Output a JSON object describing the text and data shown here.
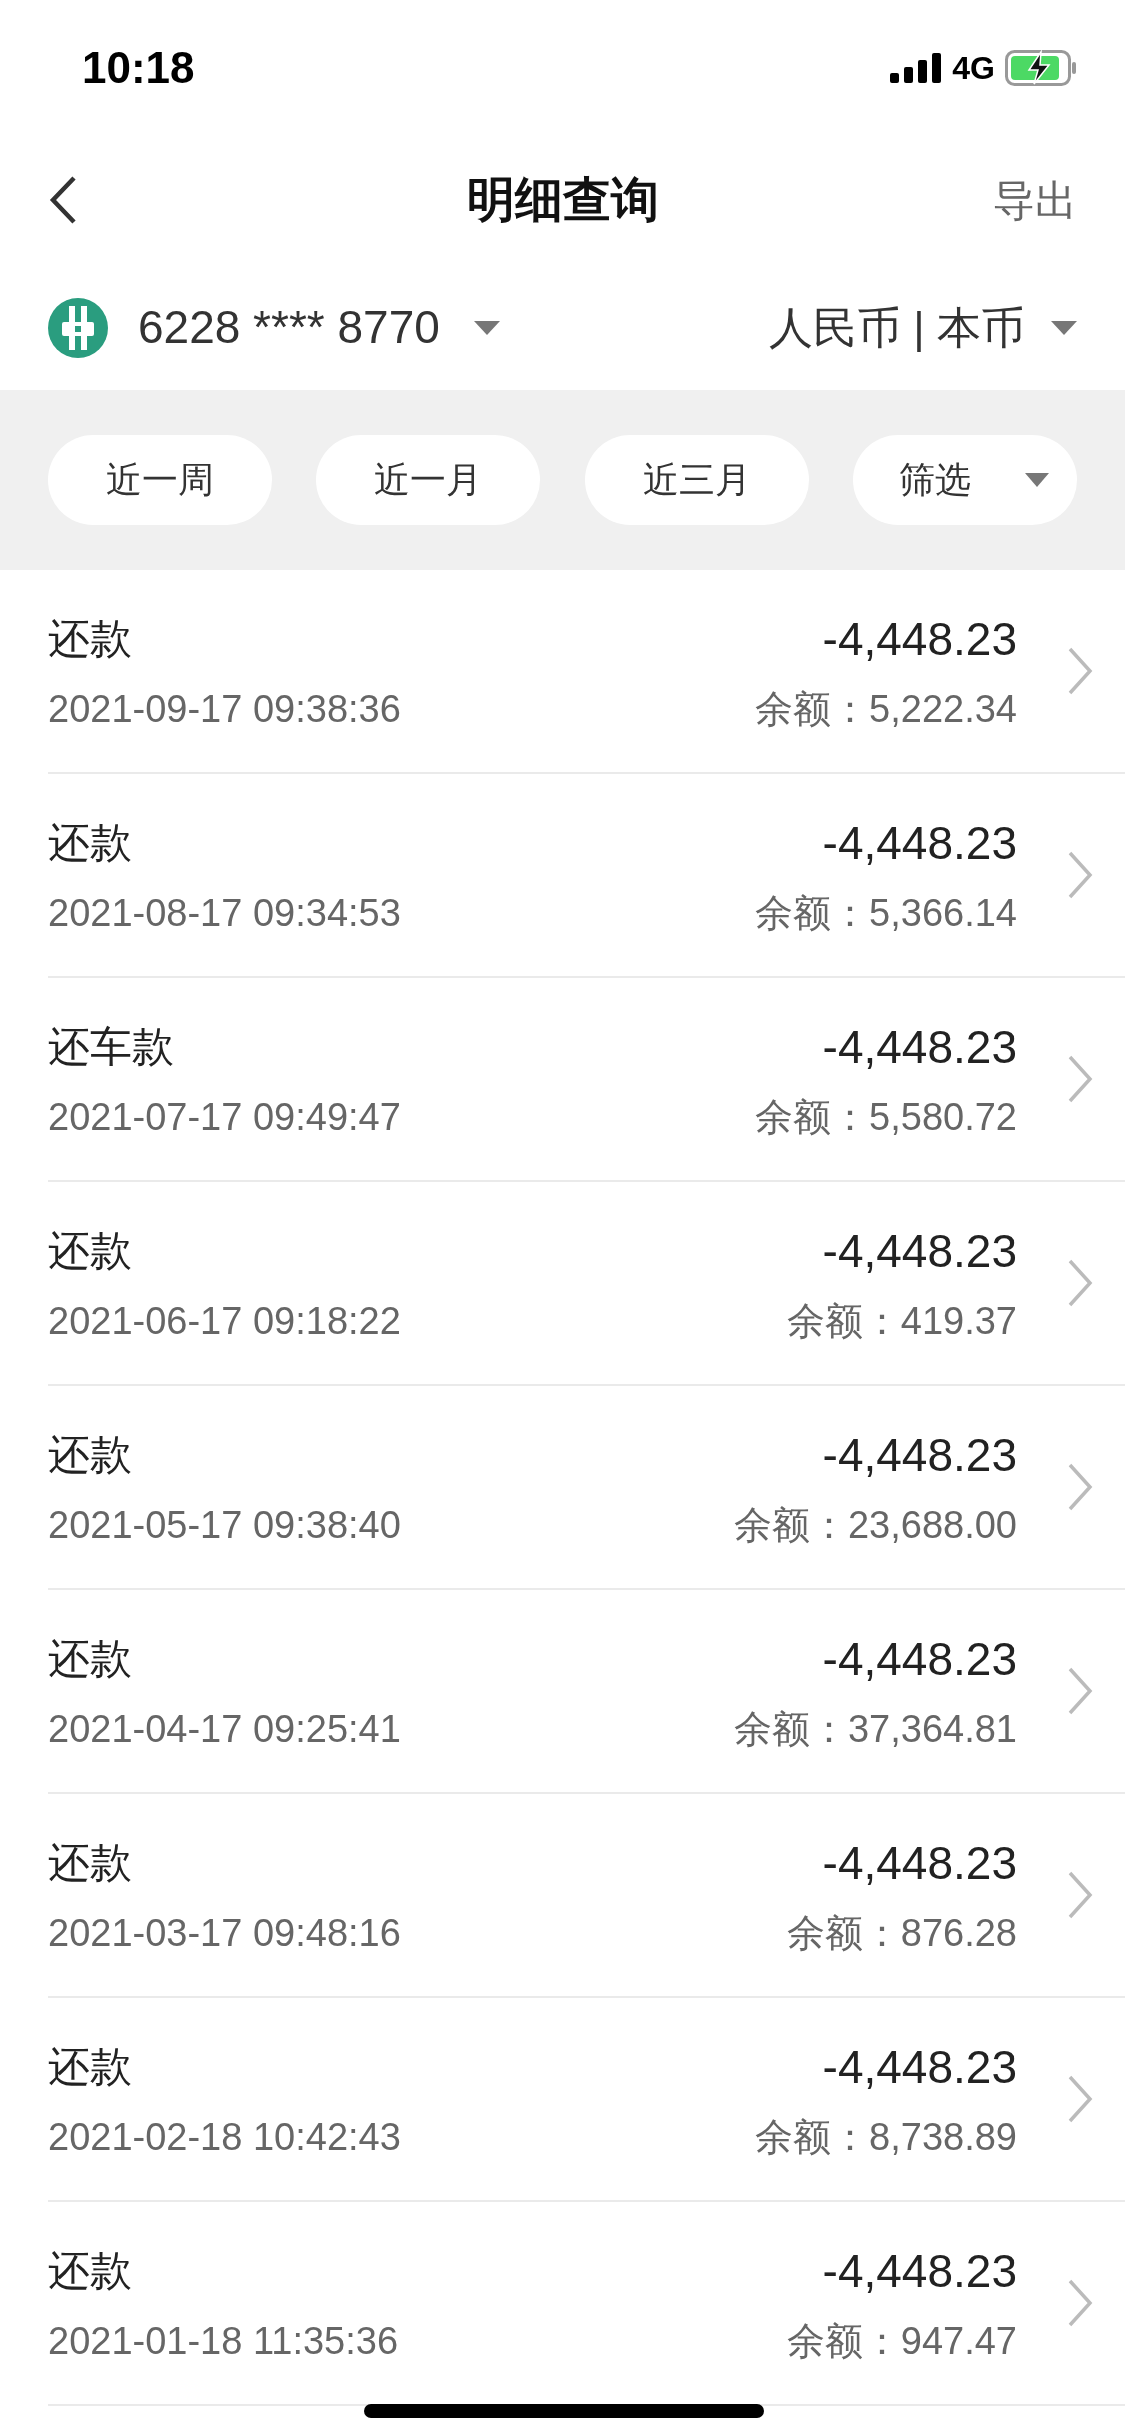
{
  "status_bar": {
    "time": "10:18",
    "network": "4G"
  },
  "nav": {
    "title": "明细查询",
    "action": "导出"
  },
  "account": {
    "number": "6228 **** 8770",
    "currency": "人民币 | 本币"
  },
  "filters": [
    {
      "label": "近一周",
      "kind": "chip"
    },
    {
      "label": "近一月",
      "kind": "chip"
    },
    {
      "label": "近三月",
      "kind": "chip"
    },
    {
      "label": "筛选",
      "kind": "dropdown"
    }
  ],
  "transactions": [
    {
      "title": "还款",
      "time": "2021-09-17 09:38:36",
      "amount": "-4,448.23",
      "balance": "余额：5,222.34"
    },
    {
      "title": "还款",
      "time": "2021-08-17 09:34:53",
      "amount": "-4,448.23",
      "balance": "余额：5,366.14"
    },
    {
      "title": "还车款",
      "time": "2021-07-17 09:49:47",
      "amount": "-4,448.23",
      "balance": "余额：5,580.72"
    },
    {
      "title": "还款",
      "time": "2021-06-17 09:18:22",
      "amount": "-4,448.23",
      "balance": "余额：419.37"
    },
    {
      "title": "还款",
      "time": "2021-05-17 09:38:40",
      "amount": "-4,448.23",
      "balance": "余额：23,688.00"
    },
    {
      "title": "还款",
      "time": "2021-04-17 09:25:41",
      "amount": "-4,448.23",
      "balance": "余额：37,364.81"
    },
    {
      "title": "还款",
      "time": "2021-03-17 09:48:16",
      "amount": "-4,448.23",
      "balance": "余额：876.28"
    },
    {
      "title": "还款",
      "time": "2021-02-18 10:42:43",
      "amount": "-4,448.23",
      "balance": "余额：8,738.89"
    },
    {
      "title": "还款",
      "time": "2021-01-18 11:35:36",
      "amount": "-4,448.23",
      "balance": "余额：947.47"
    }
  ]
}
